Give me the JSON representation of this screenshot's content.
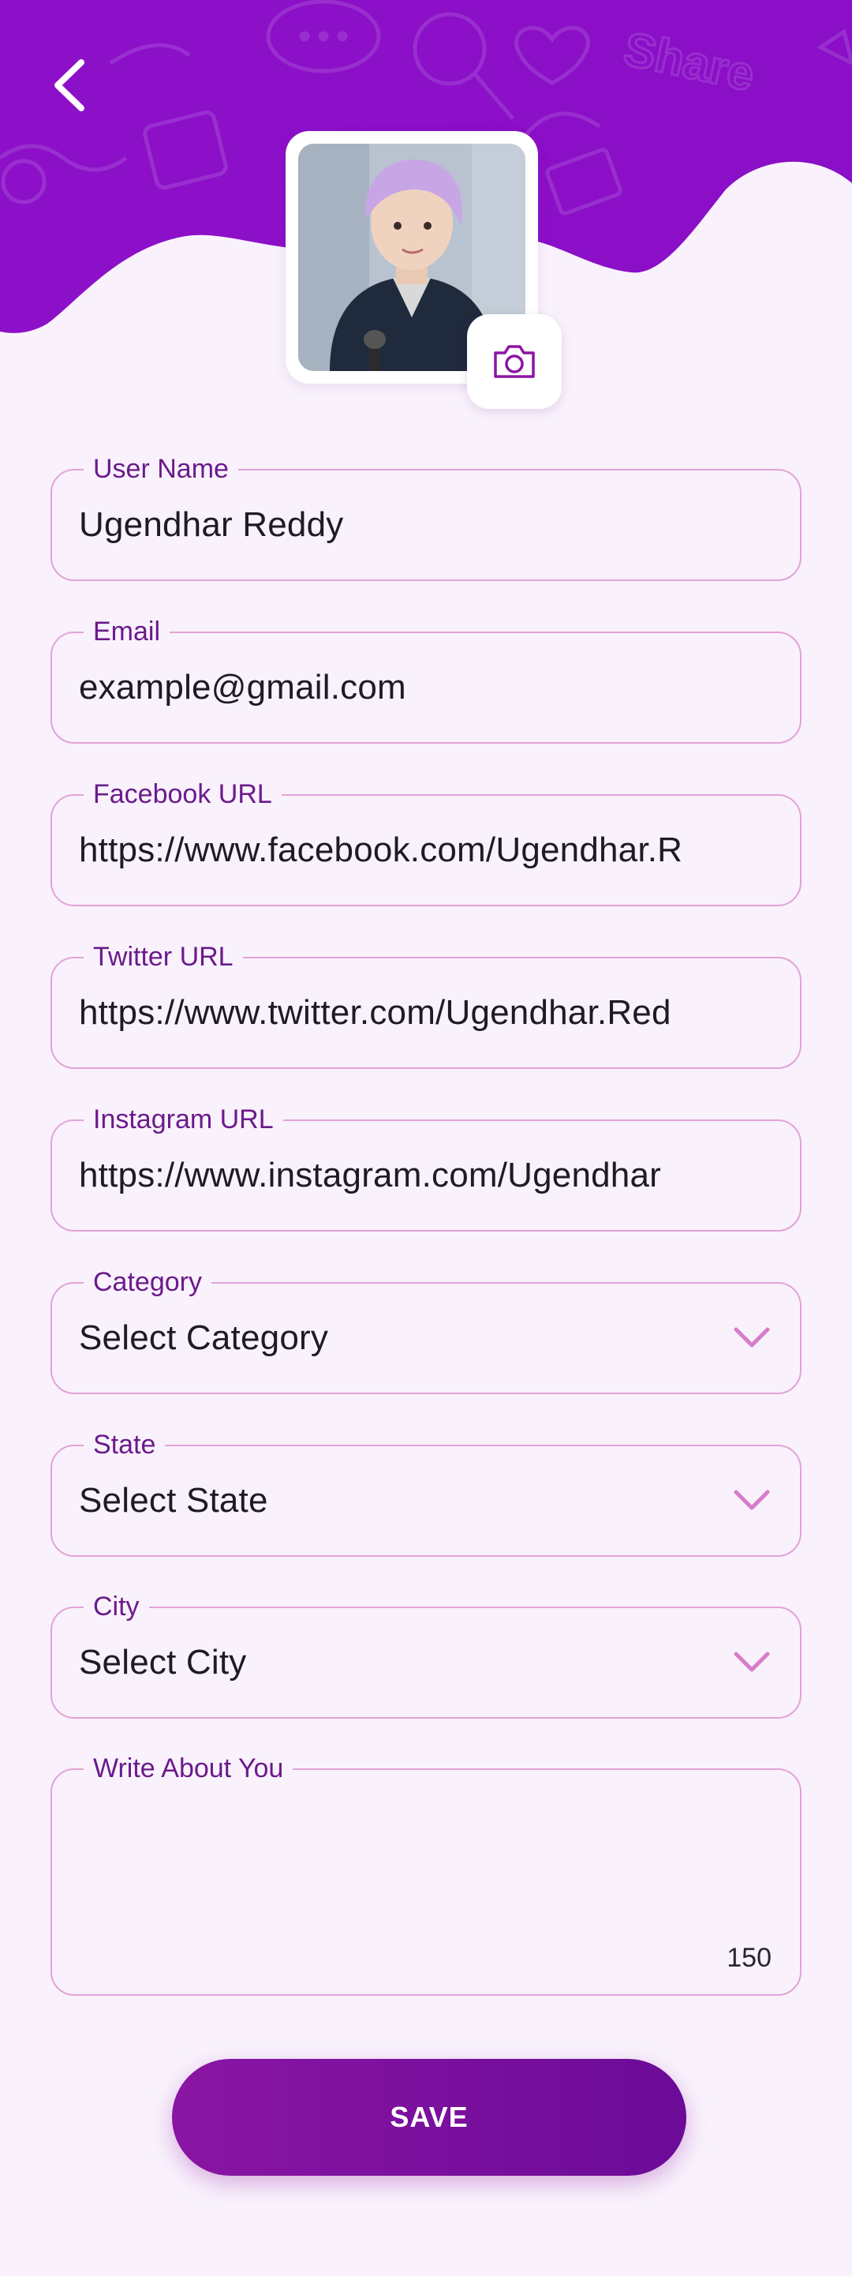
{
  "colors": {
    "header_purple": "#8a0fc6",
    "field_border": "#e4a2d8",
    "label_purple": "#6b1a8c",
    "chevron": "#d77ccb",
    "button_start": "#8a15a3",
    "button_end": "#6b0b98",
    "background": "#f9f2fc"
  },
  "header": {
    "back_icon": "chevron-left-icon",
    "doodle_text": "Share"
  },
  "profile": {
    "camera_icon": "camera-icon"
  },
  "fields": {
    "username": {
      "label": "User Name",
      "value": "Ugendhar Reddy"
    },
    "email": {
      "label": "Email",
      "value": "example@gmail.com"
    },
    "facebook": {
      "label": "Facebook URL",
      "value": "https://www.facebook.com/Ugendhar.R"
    },
    "twitter": {
      "label": "Twitter URL",
      "value": "https://www.twitter.com/Ugendhar.Red"
    },
    "instagram": {
      "label": "Instagram URL",
      "value": "https://www.instagram.com/Ugendhar"
    },
    "category": {
      "label": "Category",
      "value": "Select Category"
    },
    "state": {
      "label": "State",
      "value": "Select State"
    },
    "city": {
      "label": "City",
      "value": "Select City"
    },
    "about": {
      "label": "Write About You",
      "value": "",
      "counter": "150"
    }
  },
  "actions": {
    "save_label": "SAVE"
  }
}
